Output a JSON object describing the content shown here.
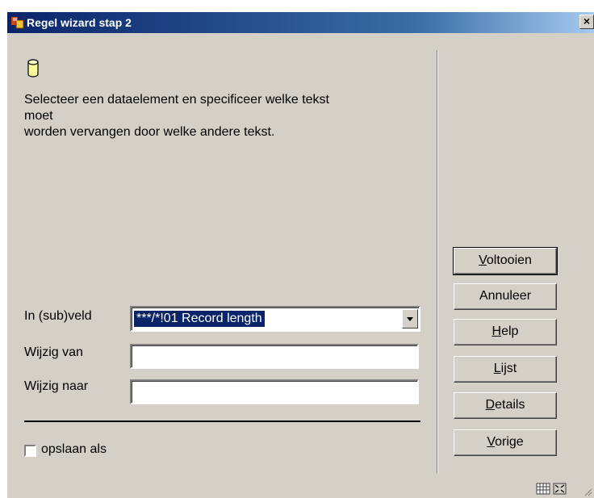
{
  "window": {
    "title": "Regel wizard stap 2",
    "close_label": "×"
  },
  "description": {
    "line1": "Selecteer een dataelement en specificeer welke tekst",
    "line2": "moet",
    "line3": "worden vervangen door welke andere tekst."
  },
  "form": {
    "field_label": "In (sub)veld",
    "field_value": "***/*!01 Record length",
    "from_label": "Wijzig van",
    "from_value": "",
    "to_label": "Wijzig naar",
    "to_value": "",
    "save_label": "opslaan als",
    "save_checked": false
  },
  "buttons": {
    "finish": {
      "pre": "",
      "key": "V",
      "post": "oltooien"
    },
    "cancel": "Annuleer",
    "help": {
      "pre": "",
      "key": "H",
      "post": "elp"
    },
    "list": {
      "pre": "",
      "key": "L",
      "post": "ijst"
    },
    "details": {
      "pre": "",
      "key": "D",
      "post": "etails"
    },
    "previous": {
      "pre": "",
      "key": "V",
      "post": "orige"
    }
  },
  "icons": {
    "app": "app-icon",
    "database": "database-icon",
    "grid": "grid-icon",
    "expand": "expand-icon"
  },
  "colors": {
    "titlebar_start": "#0a246a",
    "titlebar_end": "#a6caf0",
    "dialog_bg": "#d4d0c8",
    "selection": "#0a246a"
  }
}
